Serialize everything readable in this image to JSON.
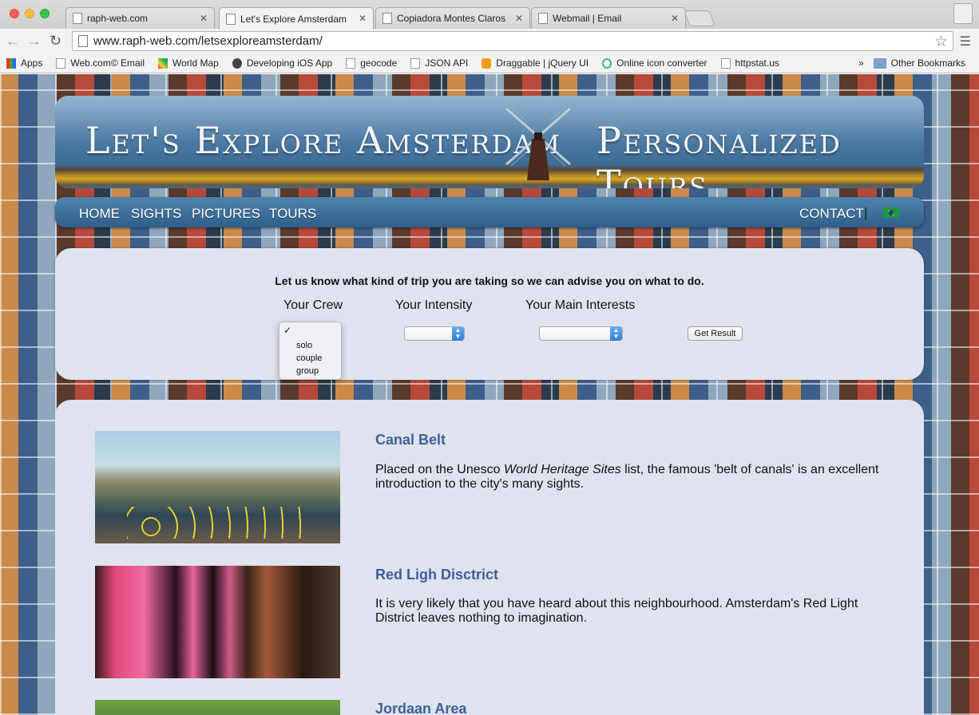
{
  "browser": {
    "tabs": [
      {
        "label": "raph-web.com",
        "active": false
      },
      {
        "label": "Let's Explore Amsterdam",
        "active": true
      },
      {
        "label": "Copiadora Montes Claros",
        "active": false
      },
      {
        "label": "Webmail | Email",
        "active": false
      }
    ],
    "url": "www.raph-web.com/letsexploreamsterdam/",
    "bookmarks": [
      {
        "label": "Apps",
        "icon": "apps-grid-icon"
      },
      {
        "label": "Web.com© Email",
        "icon": "page-icon"
      },
      {
        "label": "World Map",
        "icon": "world-map-icon"
      },
      {
        "label": "Developing iOS App",
        "icon": "apple-icon"
      },
      {
        "label": "geocode",
        "icon": "page-icon"
      },
      {
        "label": "JSON API",
        "icon": "page-icon"
      },
      {
        "label": "Draggable | jQuery UI",
        "icon": "jquery-icon"
      },
      {
        "label": "Online icon converter",
        "icon": "converter-icon"
      },
      {
        "label": "httpstat.us",
        "icon": "page-icon"
      }
    ],
    "other_bookmarks": "Other Bookmarks",
    "overflow": "»"
  },
  "site": {
    "title_left": "Let's Explore Amsterdam",
    "title_right": "Personalized Tours",
    "nav": {
      "home": "HOME",
      "sights": "SIGHTS",
      "pictures": "PICTURES",
      "tours": "TOURS",
      "contact": "CONTACT",
      "separator": "|"
    },
    "accent_color": "#3e5f9a"
  },
  "advisor": {
    "question": "Let us know what kind of trip you are taking so we can advise you on what to do.",
    "crew_label": "Your Crew",
    "intensity_label": "Your Intensity",
    "interests_label": "Your Main Interests",
    "crew_options": [
      "solo",
      "couple",
      "group"
    ],
    "crew_selected": "",
    "intensity_selected": "",
    "interests_selected": "",
    "button": "Get Result"
  },
  "items": [
    {
      "title": "Canal Belt",
      "desc_pre": "Placed on the Unesco ",
      "desc_em": "World Heritage Sites",
      "desc_post": " list, the famous 'belt of canals' is an excellent introduction to the city's many sights."
    },
    {
      "title": "Red Ligh Disctrict",
      "desc": "It is very likely that you have heard about this neighbourhood. Amsterdam's Red Light District leaves nothing to imagination."
    },
    {
      "title": "Jordaan Area"
    }
  ]
}
